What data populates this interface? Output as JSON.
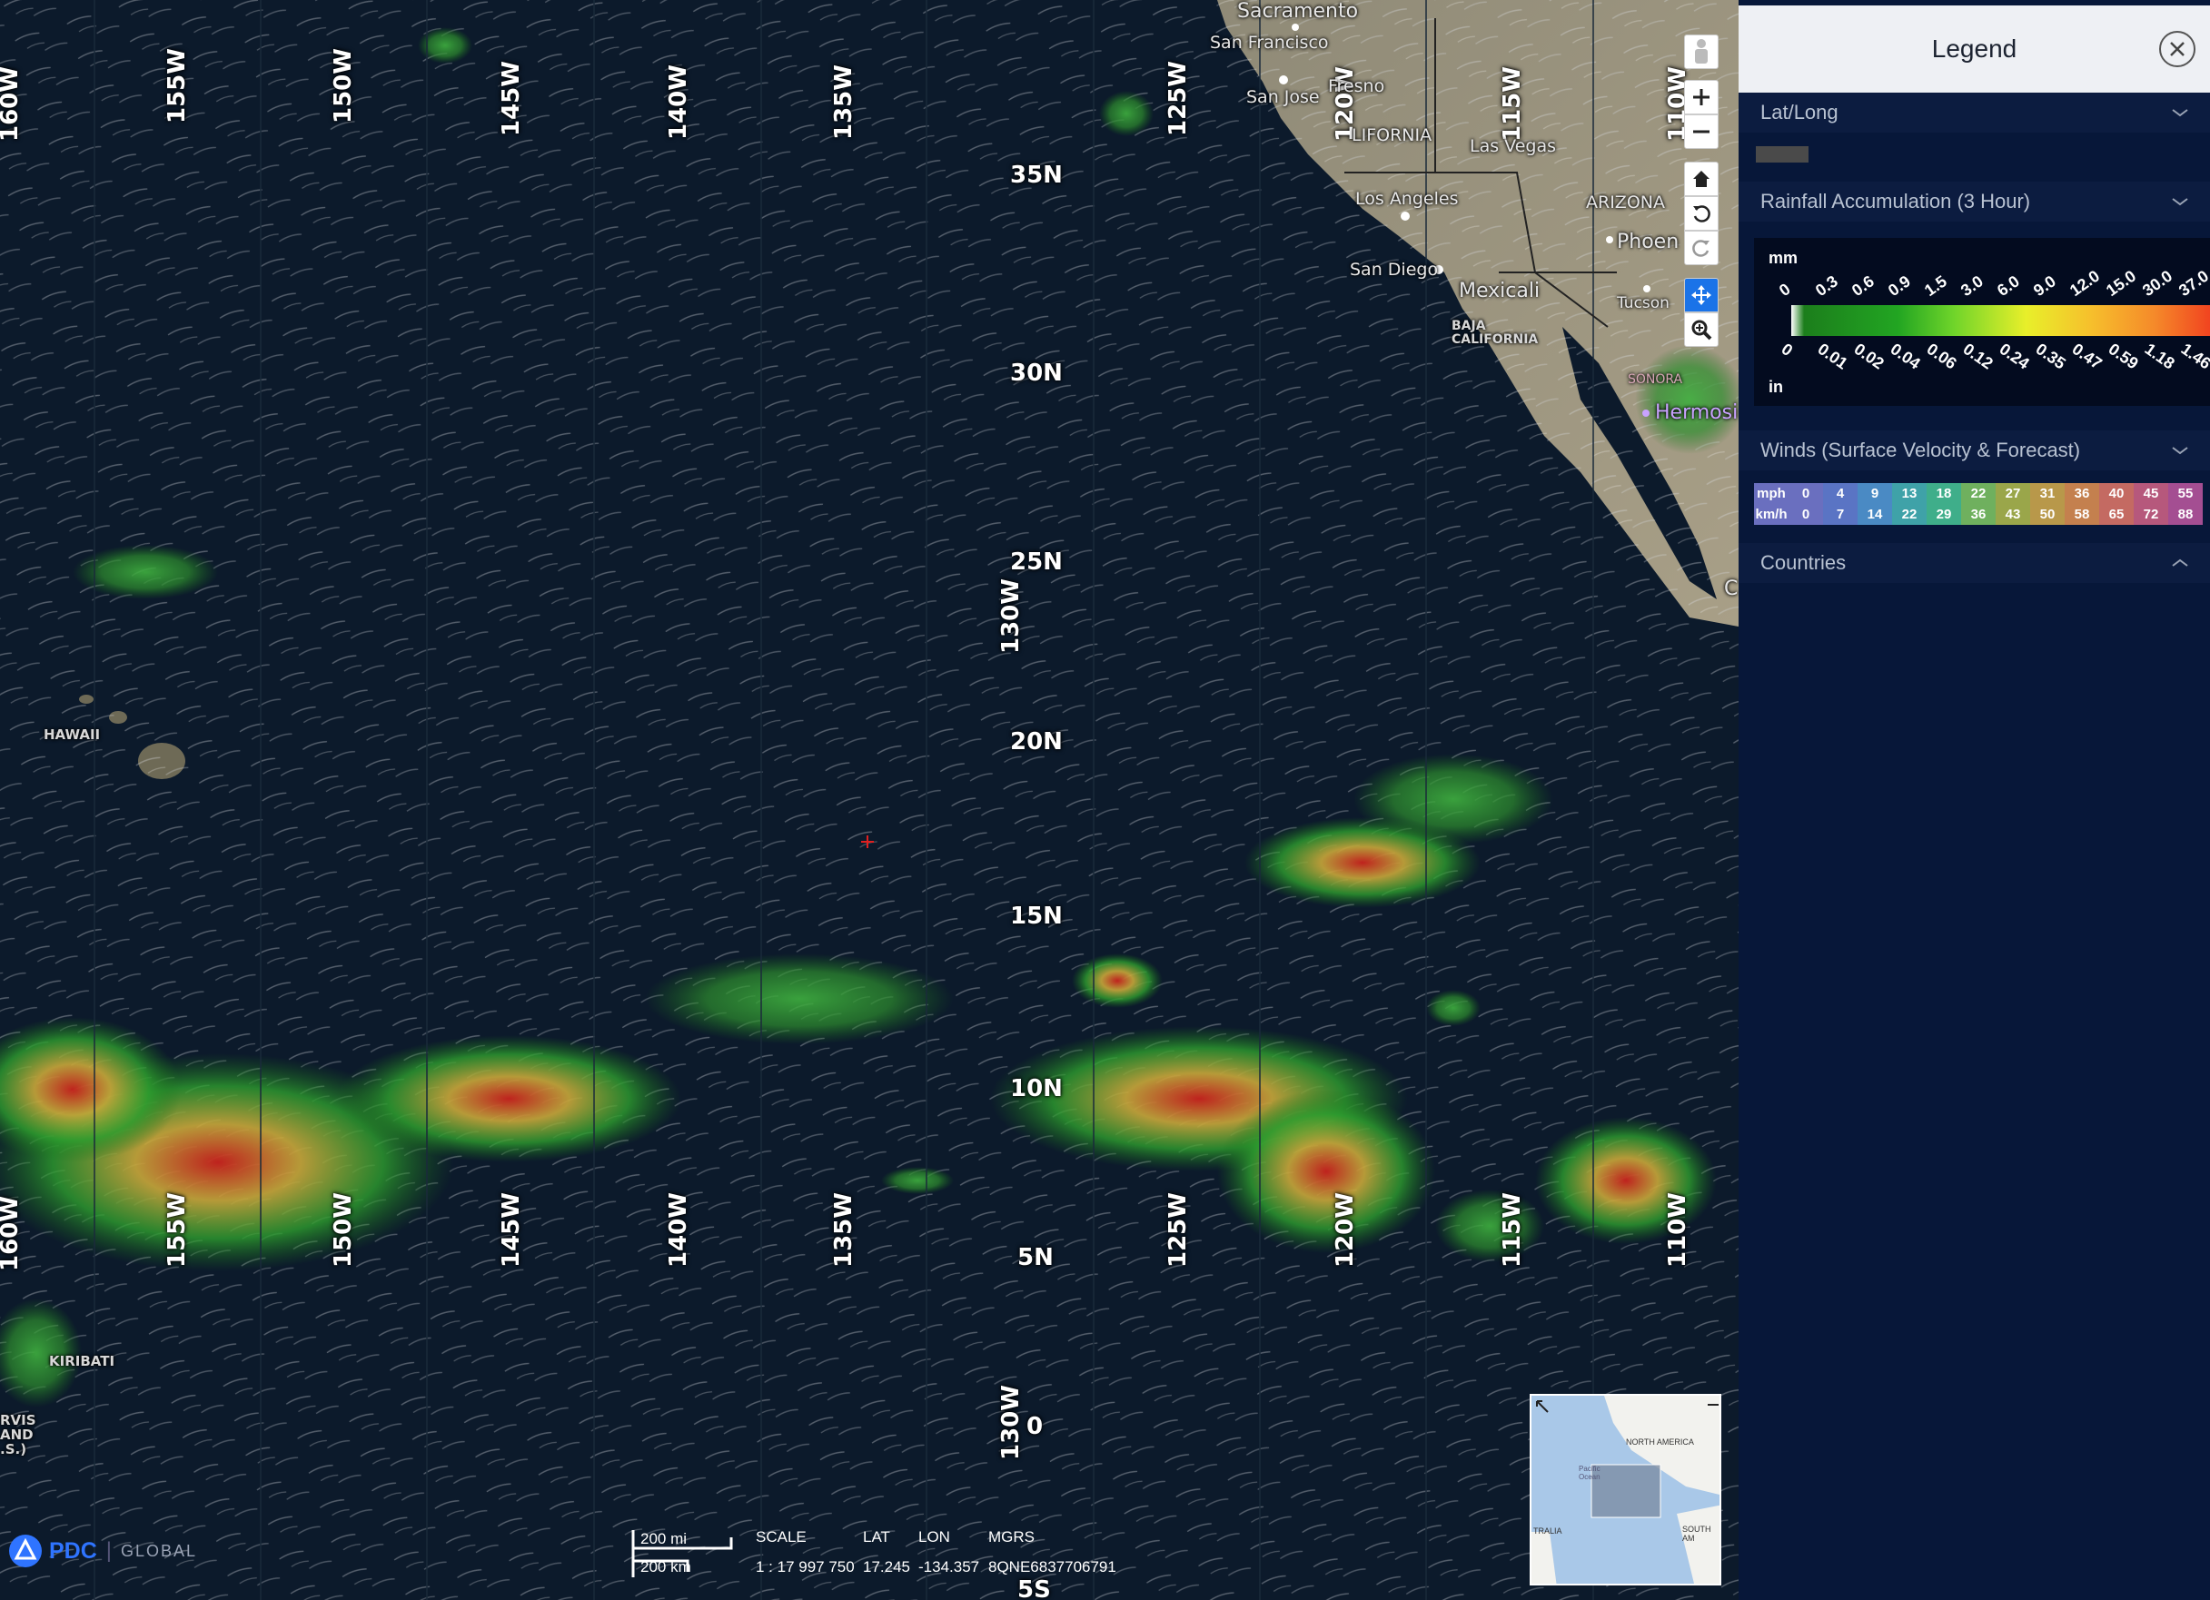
{
  "legend": {
    "title": "Legend",
    "sections": [
      {
        "label": "Lat/Long"
      },
      {
        "label": "Rainfall Accumulation (3 Hour)"
      },
      {
        "label": "Winds (Surface Velocity & Forecast)"
      },
      {
        "label": "Countries"
      }
    ],
    "rainfall": {
      "unit_top": "mm",
      "unit_bottom": "in",
      "mm_ticks": [
        "0",
        "0.3",
        "0.6",
        "0.9",
        "1.5",
        "3.0",
        "6.0",
        "9.0",
        "12.0",
        "15.0",
        "30.0",
        "37.0"
      ],
      "in_ticks": [
        "0",
        "0.01",
        "0.02",
        "0.04",
        "0.06",
        "0.12",
        "0.24",
        "0.35",
        "0.47",
        "0.59",
        "1.18",
        "1.46"
      ]
    },
    "winds": {
      "mph_label": "mph",
      "kmh_label": "km/h",
      "mph": [
        "0",
        "4",
        "9",
        "13",
        "18",
        "22",
        "27",
        "31",
        "36",
        "40",
        "45",
        "55"
      ],
      "kmh": [
        "0",
        "7",
        "14",
        "22",
        "29",
        "36",
        "43",
        "50",
        "58",
        "65",
        "72",
        "88"
      ]
    }
  },
  "map": {
    "lon_labels": [
      "160W",
      "155W",
      "150W",
      "145W",
      "140W",
      "135W",
      "125W",
      "120W",
      "115W",
      "110W"
    ],
    "lat_labels": [
      "35N",
      "30N",
      "25N",
      "20N",
      "15N",
      "10N",
      "5N",
      "0",
      "5S"
    ],
    "extra_lon_label": "130W",
    "places": {
      "sacramento": "Sacramento",
      "san_francisco": "San Francisco",
      "san_jose": "San Jose",
      "fresno": "Fresno",
      "california": "LIFORNIA",
      "las_vegas": "Las Vegas",
      "arizona": "ARIZONA",
      "los_angeles": "Los Angeles",
      "phoenix": "Phoen",
      "san_diego": "San Diego",
      "mexicali": "Mexicali",
      "tucson": "Tucson",
      "baja": "BAJA\nCALIFORNIA",
      "sonora": "SONORA",
      "hermosillo": "Hermosi",
      "hawaii": "HAWAII",
      "kiribati": "KIRIBATI",
      "jarvis": "RVIS\nAND\n.S.)",
      "c_edge": "C"
    },
    "overview": {
      "north_america": "NORTH AMERICA",
      "south_america": "SOUTH AM",
      "australia": "TRALIA",
      "pacific": "Pacific\nOcean"
    }
  },
  "status": {
    "scale_mi": "200 mi",
    "scale_km": "200 km",
    "scale_label": "SCALE",
    "lat_label": "LAT",
    "lon_label": "LON",
    "mgrs_label": "MGRS",
    "scale_value": "1 : 17 997 750",
    "lat_value": "17.245",
    "lon_value": "-134.357",
    "mgrs_value": "8QNE6837706791"
  },
  "logo": {
    "brand": "PDC",
    "suffix": "GLOBAL"
  },
  "colors": {
    "rain_low": "#2e9e2e",
    "rain_mid": "#c9c23a",
    "rain_high": "#c8231d",
    "accent": "#2f74ff"
  }
}
